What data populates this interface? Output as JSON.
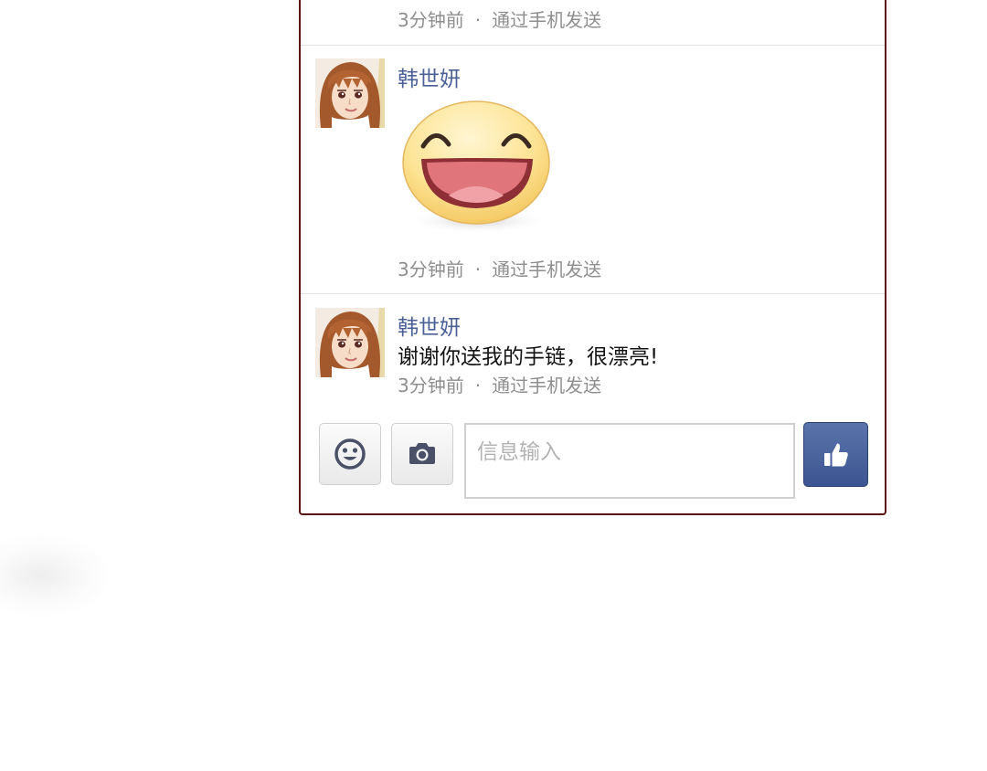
{
  "messages": [
    {
      "sender": "",
      "text": "",
      "time": "3分钟前",
      "separator": "·",
      "via": "通过手机发送"
    },
    {
      "sender": "韩世妍",
      "sticker": "laughing-face-sticker",
      "time": "3分钟前",
      "separator": "·",
      "via": "通过手机发送"
    },
    {
      "sender": "韩世妍",
      "text": "谢谢你送我的手链，很漂亮!",
      "time": "3分钟前",
      "separator": "·",
      "via": "通过手机发送"
    }
  ],
  "composer": {
    "emoji_icon": "smiley-icon",
    "camera_icon": "camera-icon",
    "placeholder": "信息输入",
    "send_icon": "thumbs-up-icon"
  },
  "colors": {
    "panel_border": "#5a1313",
    "name": "#4b6196",
    "meta": "#8e8e8e",
    "like_button": "#3f5893"
  }
}
